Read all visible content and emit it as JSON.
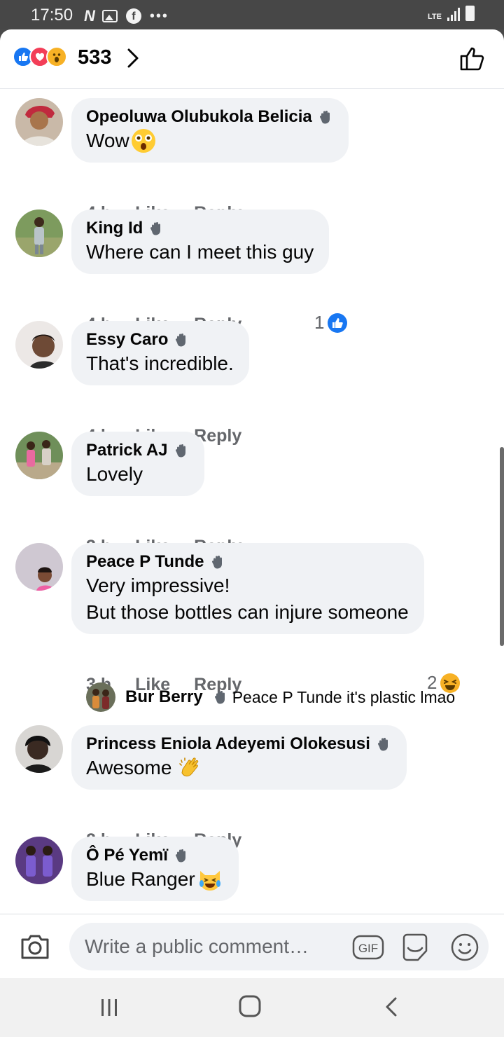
{
  "status_bar": {
    "time": "17:50",
    "network": "LTE",
    "icons": [
      "netflix-icon",
      "gallery-icon",
      "facebook-icon",
      "more-dots-icon"
    ]
  },
  "reactions": {
    "count": "533",
    "types": [
      "like",
      "love",
      "wow"
    ]
  },
  "comments": [
    {
      "name": "Opeoluwa Olubukola Belicia",
      "text": "Wow",
      "emoji": "astonished",
      "time": "4 h",
      "like": "Like",
      "reply": "Reply"
    },
    {
      "name": "King Id",
      "text": "Where can I meet this guy",
      "time": "4 h",
      "like": "Like",
      "reply": "Reply",
      "reaction_count": "1",
      "reaction_type": "like"
    },
    {
      "name": "Essy Caro",
      "text": "That's incredible.",
      "time": "4 h",
      "like": "Like",
      "reply": "Reply"
    },
    {
      "name": "Patrick AJ",
      "text": "Lovely",
      "time": "3 h",
      "like": "Like",
      "reply": "Reply"
    },
    {
      "name": "Peace P Tunde",
      "text_line1": "Very impressive!",
      "text_line2": "But those bottles can injure someone",
      "time": "3 h",
      "like": "Like",
      "reply": "Reply",
      "reaction_count": "2",
      "reaction_type": "haha"
    },
    {
      "name": "Princess Eniola Adeyemi Olokesusi",
      "text": "Awesome",
      "emoji": "clapping-hands",
      "time": "2 h",
      "like": "Like",
      "reply": "Reply"
    },
    {
      "name": "Ô Pé Yemï",
      "text": "Blue Ranger",
      "emoji": "crying-laughing-cat"
    }
  ],
  "reply_preview": {
    "name": "Bur Berry",
    "text": "Peace P Tunde it's plastic lmao"
  },
  "composer": {
    "placeholder": "Write a public comment…",
    "gif_label": "GIF"
  },
  "colors": {
    "facebook_blue": "#1877f2",
    "bubble_gray": "#f0f2f5",
    "meta_gray": "#65676b"
  }
}
